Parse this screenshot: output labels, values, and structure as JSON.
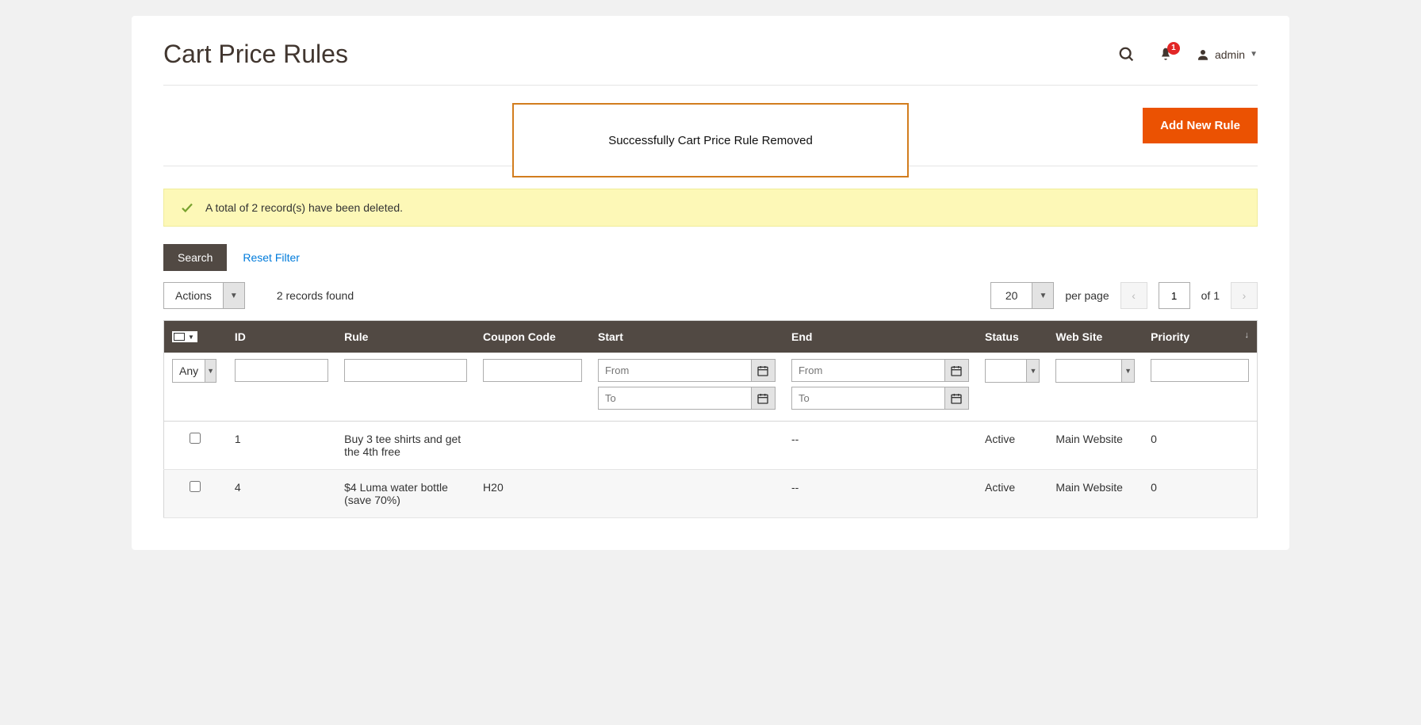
{
  "header": {
    "page_title": "Cart Price Rules",
    "notification_count": "1",
    "user_label": "admin"
  },
  "callout": {
    "message": "Successfully Cart Price Rule Removed"
  },
  "toolbar": {
    "add_rule_label": "Add New Rule"
  },
  "success": {
    "message": "A total of 2 record(s) have been deleted."
  },
  "filters": {
    "search_label": "Search",
    "reset_label": "Reset Filter",
    "actions_label": "Actions",
    "records_found": "2 records found",
    "per_page_value": "20",
    "per_page_label": "per page",
    "page_current": "1",
    "page_of": "of 1",
    "any_label": "Any",
    "from_placeholder": "From",
    "to_placeholder": "To"
  },
  "columns": {
    "id": "ID",
    "rule": "Rule",
    "coupon": "Coupon Code",
    "start": "Start",
    "end": "End",
    "status": "Status",
    "website": "Web Site",
    "priority": "Priority"
  },
  "rows": [
    {
      "id": "1",
      "rule": "Buy 3 tee shirts and get the 4th free",
      "coupon": "",
      "start": "",
      "end": "--",
      "status": "Active",
      "website": "Main Website",
      "priority": "0"
    },
    {
      "id": "4",
      "rule": "$4 Luma water bottle (save 70%)",
      "coupon": "H20",
      "start": "",
      "end": "--",
      "status": "Active",
      "website": "Main Website",
      "priority": "0"
    }
  ]
}
